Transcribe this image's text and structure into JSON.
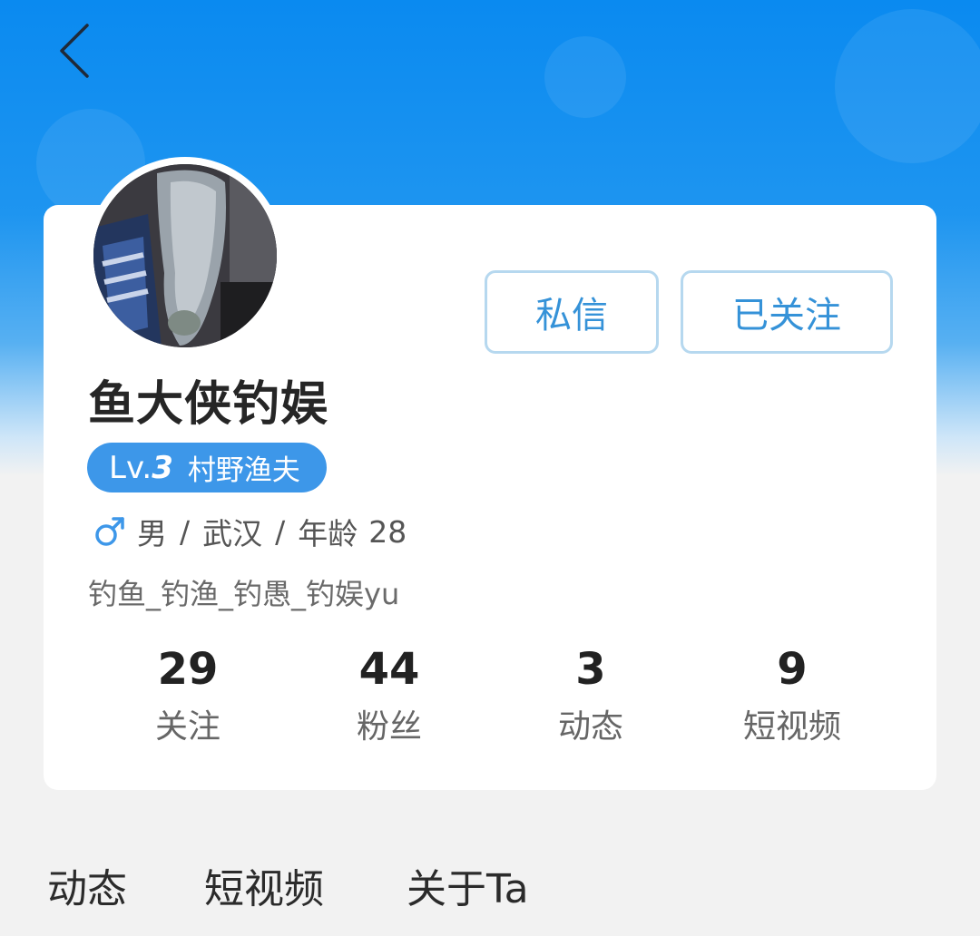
{
  "header": {
    "back_icon": "chevron-left-icon"
  },
  "profile": {
    "username": "鱼大侠钓娱",
    "level": {
      "prefix": "Lv.",
      "number": "3",
      "title": "村野渔夫"
    },
    "gender_icon": "male-icon",
    "gender": "男",
    "separator": "/",
    "city": "武汉",
    "age_label": "年龄",
    "age": "28",
    "signature": "钓鱼_钓渔_钓愚_钓娱yu"
  },
  "actions": {
    "message_label": "私信",
    "follow_label": "已关注"
  },
  "stats": [
    {
      "value": "29",
      "label": "关注"
    },
    {
      "value": "44",
      "label": "粉丝"
    },
    {
      "value": "3",
      "label": "动态"
    },
    {
      "value": "9",
      "label": "短视频"
    }
  ],
  "tabs": [
    {
      "label": "动态"
    },
    {
      "label": "短视频"
    },
    {
      "label": "关于Ta"
    }
  ],
  "colors": {
    "accent": "#3d97e9",
    "button_text": "#3592d8",
    "button_border": "#b6d8ef",
    "banner_blue": "#0a8af0",
    "background": "#f2f2f2"
  }
}
